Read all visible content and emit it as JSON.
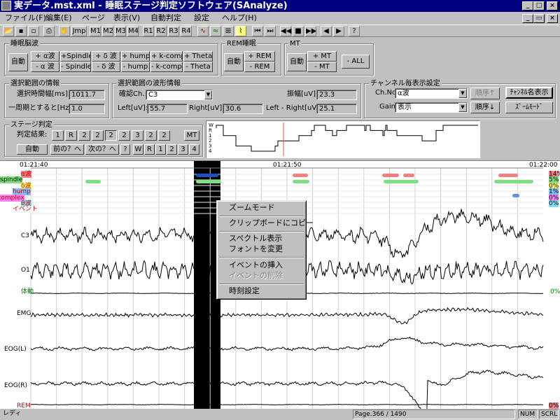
{
  "window": {
    "title": "実データ.mst.xml - 睡眠ステージ判定ソフトウェア(SAnalyze)",
    "min": "_",
    "max": "□",
    "close": "×"
  },
  "menu": [
    {
      "label": "ファイル(F)"
    },
    {
      "label": "編集(E)"
    },
    {
      "label": "ページ"
    },
    {
      "label": "表示(V)"
    },
    {
      "label": "自動判定"
    },
    {
      "label": "設定"
    },
    {
      "label": "ヘルプ(H)"
    }
  ],
  "doc_controls": {
    "min": "_",
    "restore": "▭",
    "close": "×"
  },
  "toolbar": {
    "jmp": "Jmp",
    "m": [
      "M1",
      "M2",
      "M3",
      "M4"
    ],
    "r": [
      "R1",
      "R2",
      "R3",
      "R4"
    ]
  },
  "sleep_wave": {
    "title": "睡眠脳波",
    "auto": "自動",
    "plus": [
      "+ α波",
      "+Spindle",
      "+ δ 波",
      "+ hump",
      "+ k-comp.",
      "+ Theta"
    ],
    "minus": [
      "- α 波",
      "- Spindle",
      "- δ 波",
      "- hump",
      "- k-comp.",
      "- Theta"
    ]
  },
  "rem": {
    "title": "REM睡眠",
    "auto": "自動",
    "plus": "+ REM",
    "minus": "- REM"
  },
  "mt": {
    "title": "MT",
    "auto": "自動",
    "plus": "+ MT",
    "minus": "- MT",
    "all": "- ALL"
  },
  "range_info": {
    "title": "選択範囲の情報",
    "time_label": "選択時間幅[ms]:",
    "time_value": "1011.7",
    "freq_label": "一周期とすると[Hz]:",
    "freq_value": "1.0"
  },
  "waveform_info": {
    "title": "選択範囲の波形情報",
    "ch_label": "確認Ch.:",
    "ch_value": "C3",
    "amp_label": "振幅[uV]:",
    "amp_value": "23.3",
    "left_label": "Left[uV]:",
    "left_value": "55.7",
    "right_label": "Right[uV]:",
    "right_value": "30.6",
    "diff_label": "Left - Right[uV]:",
    "diff_value": "25.1"
  },
  "channel_settings": {
    "title": "チャンネル毎表示設定",
    "chno_label": "Ch.No.:",
    "chno_value": "α波",
    "gain_label": "Gain:",
    "gain_value": "表示",
    "order_up": "順序↑",
    "order_down": "順序↓",
    "ch_name_btn": "ﾁｬﾝﾈﾙ名表示",
    "zoom_btn": "ｽﾞｰﾑﾓｰﾄﾞ"
  },
  "stage": {
    "title": "ステージ判定",
    "result_label": "判定結果:",
    "results": [
      "1",
      "R",
      "2",
      "2",
      "2",
      "2",
      "3",
      "2",
      "2"
    ],
    "mt": "MT",
    "auto": "自動",
    "prev": "前の？へ",
    "next": "次の？へ",
    "q": "?",
    "stages": [
      "W",
      "R",
      "1",
      "2",
      "3",
      "4"
    ],
    "hyp_labels": [
      "W",
      "R",
      "1",
      "2",
      "3",
      "4"
    ]
  },
  "graph": {
    "time_left": "01:21:40",
    "time_mid": "01:21:50",
    "time_right": "01:22:00",
    "channels": [
      {
        "name": "α波",
        "pct": "14%"
      },
      {
        "name": "spindle",
        "pct": "5%"
      },
      {
        "name": "δ波",
        "pct": "0%"
      },
      {
        "name": "hump",
        "pct": "1%"
      },
      {
        "name": "k-complex",
        "pct": "0%"
      },
      {
        "name": "θ波",
        "pct": "0%"
      },
      {
        "name": "イベント",
        "pct": ""
      }
    ],
    "signals": [
      "C3",
      "O1",
      "体動",
      "EMG",
      "EOG(L)",
      "EOG(R)",
      "REM"
    ],
    "body_pct": "0%",
    "rem_pct": "0%"
  },
  "context_menu": {
    "items": [
      "ズームモード",
      "クリップボードにコピー",
      "スペクトル表示",
      "フォントを変更",
      "イベントの挿入",
      "イベントの削除",
      "時刻設定"
    ]
  },
  "status": {
    "left": "レディ",
    "page": "Page.366 / 1490",
    "num": "NUM",
    "scrl": "SCRL"
  }
}
